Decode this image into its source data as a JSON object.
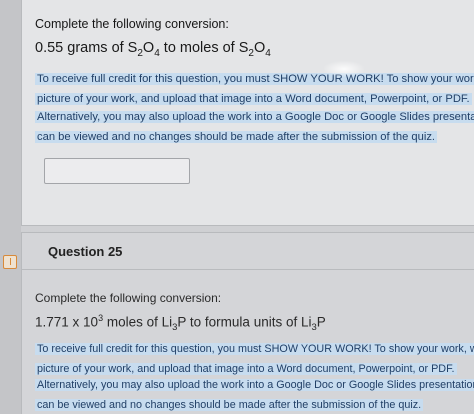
{
  "question_24": {
    "prompt": "Complete the following conversion:",
    "equation_prefix": "0.55 grams of S",
    "equation_sub1": "2",
    "equation_mid1": "O",
    "equation_sub2": "4",
    "equation_mid2": " to moles of S",
    "equation_sub3": "2",
    "equation_mid3": "O",
    "equation_sub4": "4",
    "instructions_line1": "To receive full credit for this question, you must SHOW YOUR WORK! To show your work, write",
    "instructions_line2": "picture of your work, and upload that image into a Word document, Powerpoint, or PDF.",
    "alternative_line1": "Alternatively, you may also upload the work into a Google Doc or Google Slides presentation, bu",
    "alternative_line2": "can be viewed and no changes should be made after the submission of the quiz.",
    "answer_value": ""
  },
  "question_25": {
    "title": "Question 25",
    "prompt": "Complete the following conversion:",
    "equation_coef": "1.771 x 10",
    "equation_exp": "3",
    "equation_mid1": " moles of Li",
    "equation_sub1": "3",
    "equation_mid2": "P to formula units of Li",
    "equation_sub2": "3",
    "equation_end": "P",
    "instructions_line1": "To receive full credit for this question, you must SHOW YOUR WORK! To show your work, write it",
    "instructions_line2": "picture of your work, and upload that image into a Word document, Powerpoint, or PDF.",
    "alternative_line1": "Alternatively, you may also upload the work into a Google Doc or Google Slides presentation, but y",
    "alternative_line2": "can be viewed and no changes should be made after the submission of the quiz."
  },
  "icons": {
    "flag": "flag-icon"
  },
  "colors": {
    "highlight": "#c7dcef",
    "highlight_text": "#213f66",
    "flag": "#d88a3a"
  }
}
